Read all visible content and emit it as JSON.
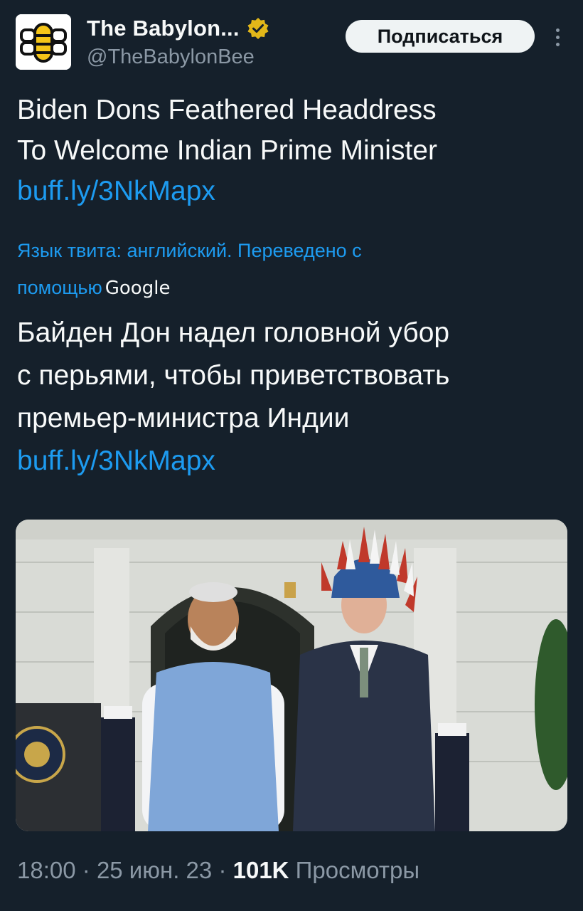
{
  "account": {
    "name": "The Babylon...",
    "handle": "@TheBabylonBee",
    "subscribe_label": "Подписаться",
    "avatar": "babylon-bee-logo",
    "verified_icon": "gold-verified-badge-icon"
  },
  "tweet": {
    "lines": [
      "Biden Dons Feathered Headdress",
      "To Welcome Indian Prime Minister"
    ],
    "link": "buff.ly/3NkMapx"
  },
  "translation": {
    "note_line1": "Язык твита: английский. Переведено с",
    "note_line2_prefix": "помощью",
    "google": "Google",
    "lines": [
      "Байден Дон надел головной убор",
      "с перьями, чтобы приветствовать",
      "премьер-министра Индии"
    ],
    "link": "buff.ly/3NkMapx"
  },
  "meta": {
    "time": "18:00",
    "date": "25 июн. 23",
    "separator": "·",
    "views_count": "101K",
    "views_label": "Просмотры"
  },
  "colors": {
    "background": "#15202b",
    "link": "#1d9bf0",
    "secondary_text": "#8b98a5",
    "verified_gold": "#e2b719"
  }
}
